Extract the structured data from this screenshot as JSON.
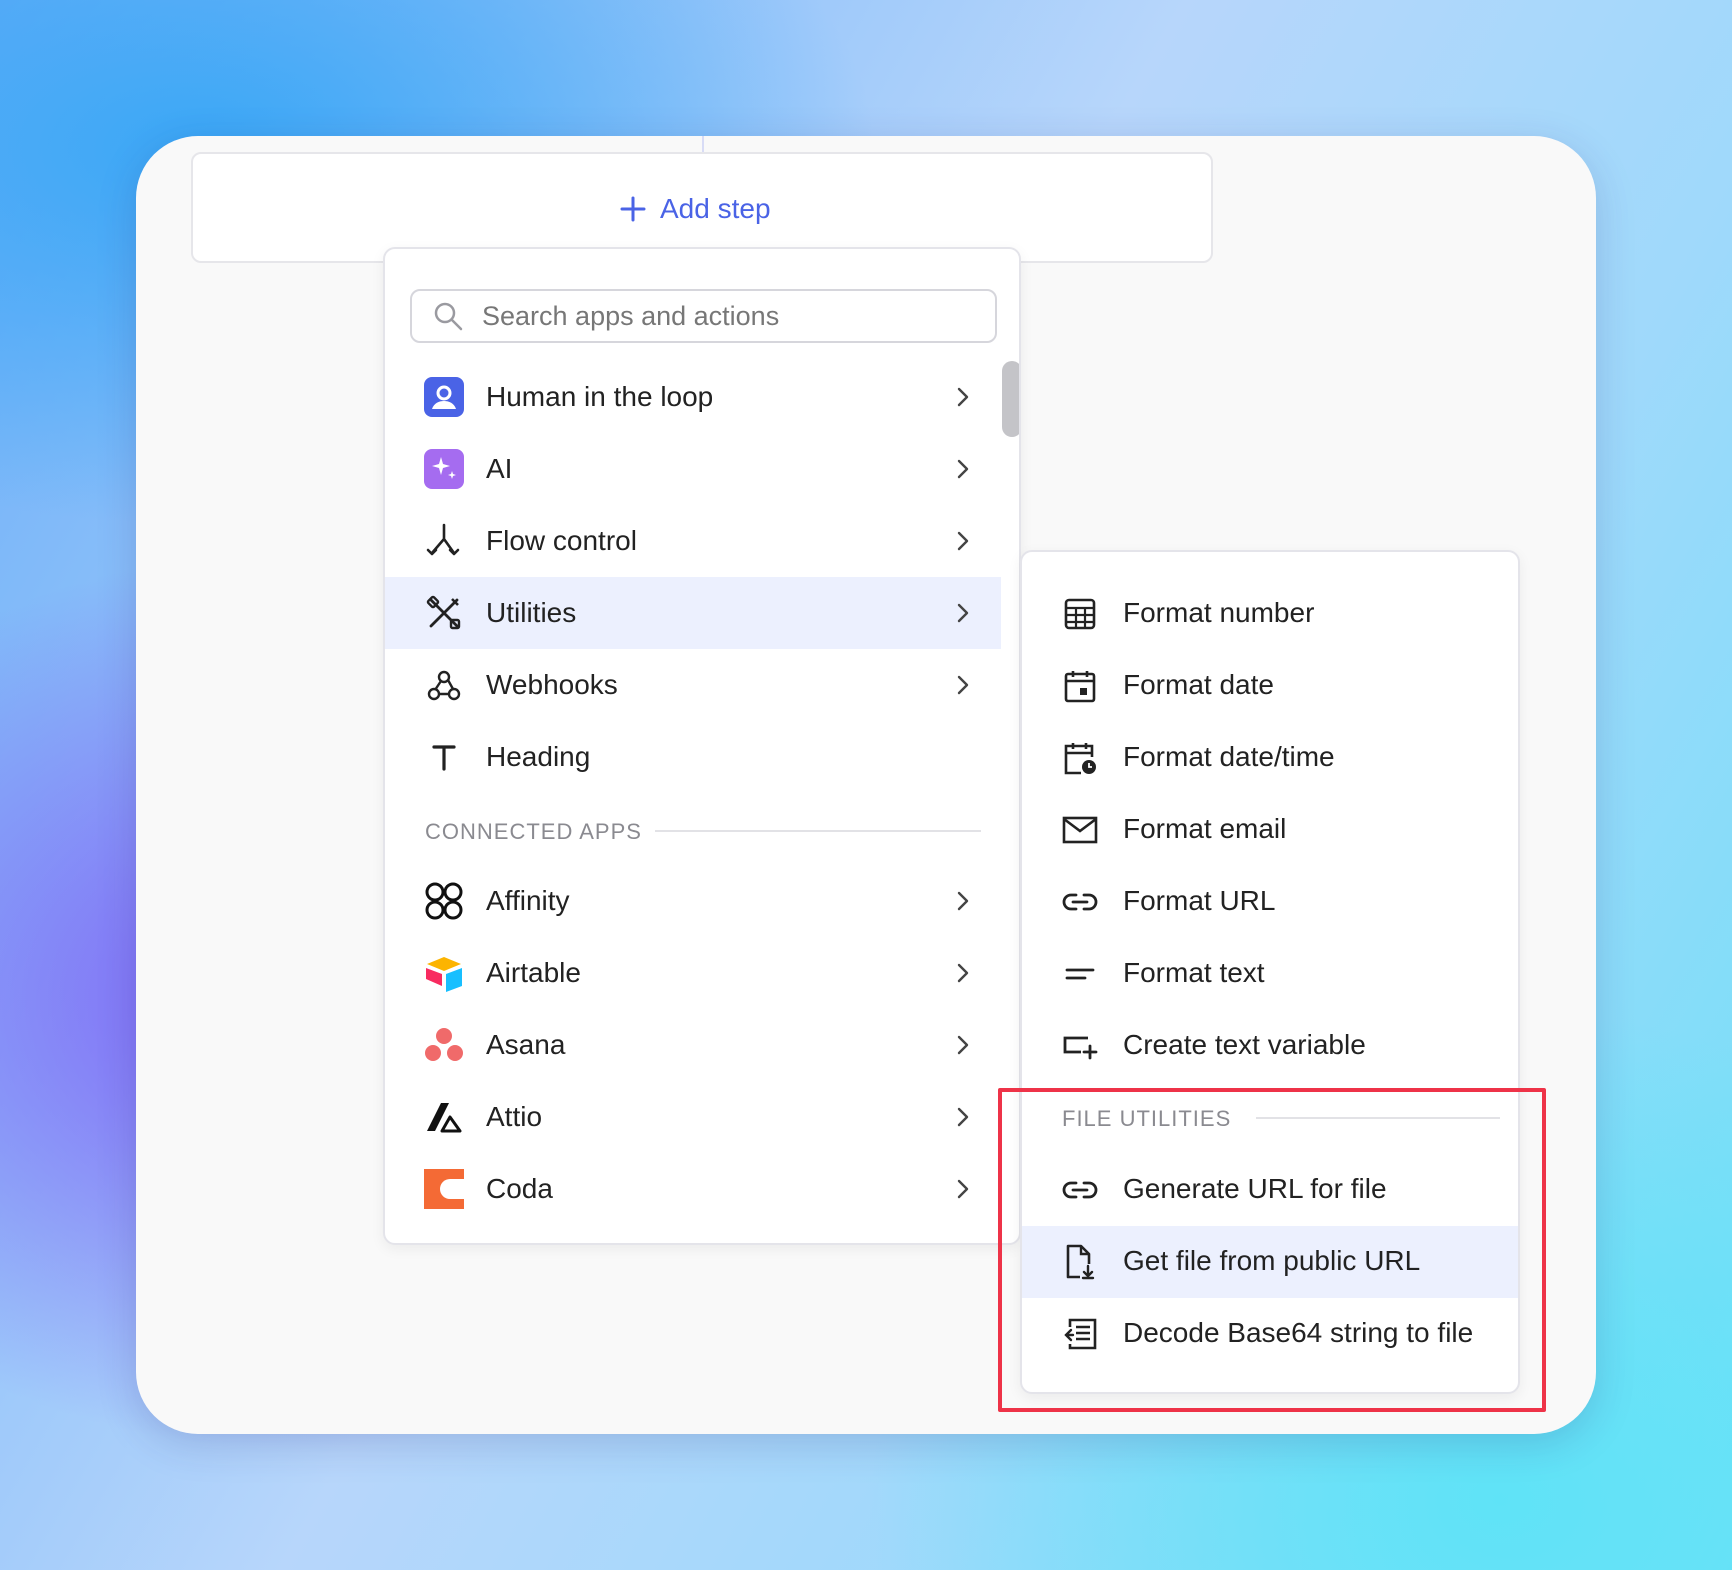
{
  "add_step": {
    "label": "Add step"
  },
  "search": {
    "placeholder": "Search apps and actions"
  },
  "menu": {
    "items": [
      {
        "label": "Human in the loop",
        "icon": "user-icon"
      },
      {
        "label": "AI",
        "icon": "sparkles-icon"
      },
      {
        "label": "Flow control",
        "icon": "branch-icon"
      },
      {
        "label": "Utilities",
        "icon": "tools-icon"
      },
      {
        "label": "Webhooks",
        "icon": "webhook-icon"
      },
      {
        "label": "Heading",
        "icon": "heading-icon"
      }
    ],
    "connected_apps_label": "CONNECTED APPS",
    "apps": [
      {
        "label": "Affinity",
        "icon": "affinity-logo"
      },
      {
        "label": "Airtable",
        "icon": "airtable-logo"
      },
      {
        "label": "Asana",
        "icon": "asana-logo"
      },
      {
        "label": "Attio",
        "icon": "attio-logo"
      },
      {
        "label": "Coda",
        "icon": "coda-logo"
      }
    ]
  },
  "submenu": {
    "items": [
      {
        "label": "Format number",
        "icon": "calculator-icon"
      },
      {
        "label": "Format date",
        "icon": "calendar-icon"
      },
      {
        "label": "Format date/time",
        "icon": "calendar-clock-icon"
      },
      {
        "label": "Format email",
        "icon": "envelope-icon"
      },
      {
        "label": "Format URL",
        "icon": "link-icon"
      },
      {
        "label": "Format text",
        "icon": "text-lines-icon"
      },
      {
        "label": "Create text variable",
        "icon": "text-variable-icon"
      }
    ],
    "file_utilities_label": "FILE UTILITIES",
    "file_items": [
      {
        "label": "Generate URL for file",
        "icon": "link-icon"
      },
      {
        "label": "Get file from public URL",
        "icon": "file-download-icon"
      },
      {
        "label": "Decode Base64 string to file",
        "icon": "decode-file-icon"
      }
    ]
  },
  "colors": {
    "accent": "#4a63e6",
    "active_row": "#ecf0fe",
    "highlight_border": "#ee3348"
  }
}
